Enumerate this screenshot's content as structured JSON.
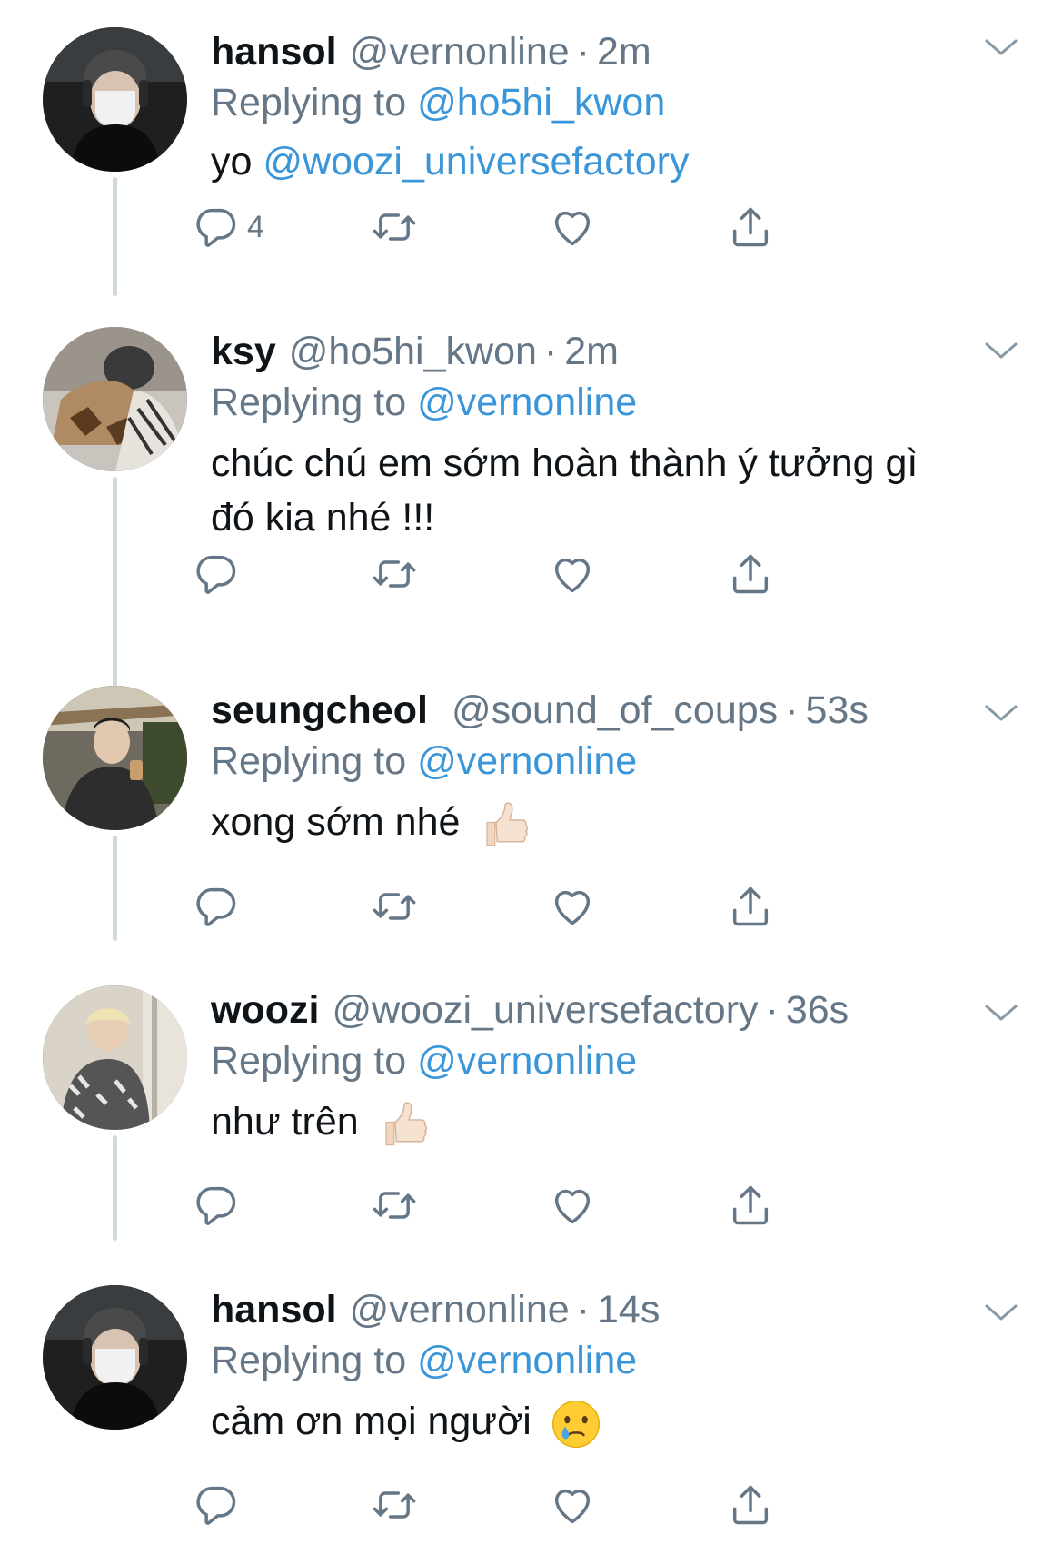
{
  "tweets": [
    {
      "name": "hansol",
      "handle": "@vernonline",
      "time": "2m",
      "reply_prefix": "Replying to",
      "reply_to": "@ho5hi_kwon",
      "body_text": "yo ",
      "body_mention": "@woozi_universefactory",
      "reply_count": "4"
    },
    {
      "name": "ksy",
      "handle": "@ho5hi_kwon",
      "time": "2m",
      "reply_prefix": "Replying to",
      "reply_to": "@vernonline",
      "body_line1": "chúc chú em sớm hoàn thành ý tưởng gì",
      "body_line2": "đó kia nhé !!!"
    },
    {
      "name": "seungcheol",
      "handle": "@sound_of_coups",
      "time": "53s",
      "reply_prefix": "Replying to",
      "reply_to": "@vernonline",
      "body_text": "xong sớm nhé",
      "emoji": "thumbs-up-light-skin"
    },
    {
      "name": "woozi",
      "handle": "@woozi_universefactory",
      "time": "36s",
      "reply_prefix": "Replying to",
      "reply_to": "@vernonline",
      "body_text": "như trên",
      "emoji": "thumbs-up-light-skin"
    },
    {
      "name": "hansol",
      "handle": "@vernonline",
      "time": "14s",
      "reply_prefix": "Replying to",
      "reply_to": "@vernonline",
      "body_text": "cảm ơn mọi người",
      "emoji": "crying-face"
    }
  ],
  "separator": "·",
  "colors": {
    "mention": "#3a96d8",
    "secondary_text": "#657786",
    "thread_line": "#cfd9de",
    "icon": "#657786"
  },
  "icons": [
    "reply-icon",
    "retweet-icon",
    "like-icon",
    "share-icon",
    "chevron-down-icon"
  ]
}
